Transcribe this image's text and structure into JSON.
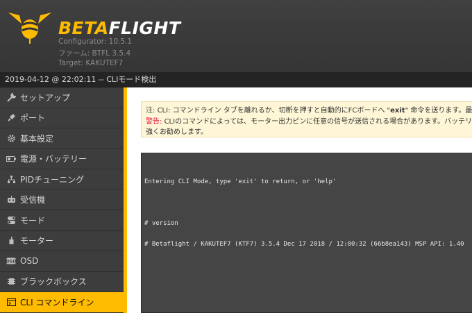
{
  "app": {
    "brand_left": "BETA",
    "brand_right": "FLIGHT",
    "configurator": "Configurator: 10.5.1",
    "firmware": "ファーム: BTFL 3.5.4",
    "target": "Target: KAKUTEF7"
  },
  "status": {
    "text": "2019-04-12 @ 22:02:11 -- CLIモード検出"
  },
  "sidebar": {
    "items": [
      {
        "label": "セットアップ",
        "icon": "wrench-icon"
      },
      {
        "label": "ポート",
        "icon": "plug-icon"
      },
      {
        "label": "基本設定",
        "icon": "gear-icon"
      },
      {
        "label": "電源・バッテリー",
        "icon": "battery-icon"
      },
      {
        "label": "PIDチューニング",
        "icon": "pid-icon"
      },
      {
        "label": "受信機",
        "icon": "receiver-icon"
      },
      {
        "label": "モード",
        "icon": "toggle-icon"
      },
      {
        "label": "モーター",
        "icon": "motor-icon"
      },
      {
        "label": "OSD",
        "icon": "osd-icon"
      },
      {
        "label": "ブラックボックス",
        "icon": "chip-icon"
      },
      {
        "label": "CLI コマンドライン",
        "icon": "terminal-icon",
        "active": true
      }
    ]
  },
  "note": {
    "label1": "注:",
    "text1_a": "CLI: コマンドライン タブを離れるか、切断を押すと自動的にFCボードへ \"",
    "text1_cmd": "exit",
    "text1_b": "\" 命令を送ります。最新ファ",
    "warn_label": "警告:",
    "text2": "CLIのコマンドによっては、モーター出力ピンに任意の信号が送信される場合があります。バッテリーが",
    "text3": "強くお勧めします。"
  },
  "console": {
    "line1": "Entering CLI Mode, type 'exit' to return, or 'help'",
    "line2": "# version",
    "line3": "# Betaflight / KAKUTEF7 (KTF7) 3.5.4 Dec 17 2018 / 12:00:32 (66b8ea143) MSP API: 1.40"
  },
  "colors": {
    "accent": "#ffbb00",
    "warning": "#e2123f",
    "console_bg": "#454545"
  }
}
